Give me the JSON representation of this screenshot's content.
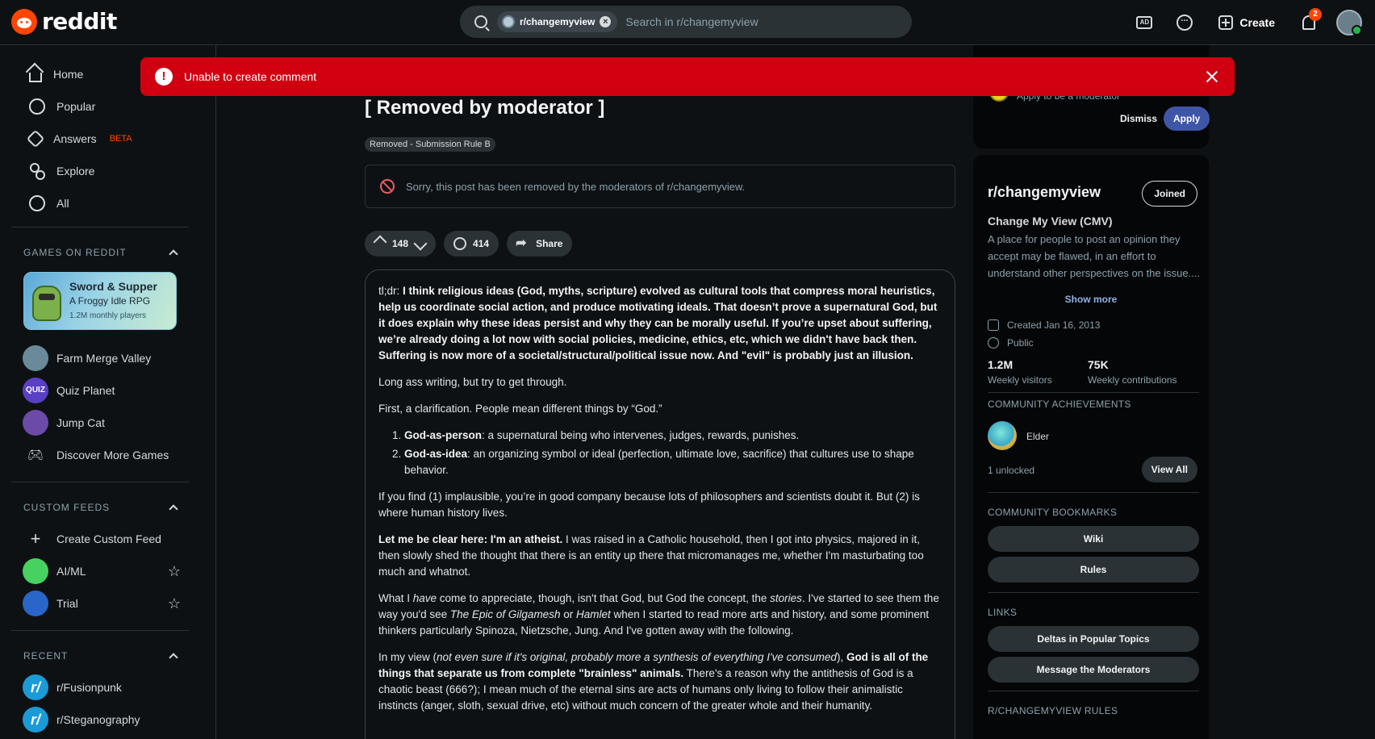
{
  "header": {
    "logo_text": "reddit",
    "search_chip": "r/changemyview",
    "search_placeholder": "Search in r/changemyview",
    "create_label": "Create",
    "notif_count": "2"
  },
  "toast": {
    "message": "Unable to create comment",
    "color": "#d00010"
  },
  "sidebar": {
    "nav": [
      {
        "label": "Home",
        "icon": "home-icon"
      },
      {
        "label": "Popular",
        "icon": "popular-icon"
      },
      {
        "label": "Answers",
        "icon": "answers-icon",
        "badge": "BETA"
      },
      {
        "label": "Explore",
        "icon": "explore-icon"
      },
      {
        "label": "All",
        "icon": "all-icon"
      }
    ],
    "games_title": "GAMES ON REDDIT",
    "game_card": {
      "title": "Sword & Supper",
      "subtitle": "A Froggy Idle RPG",
      "players": "1.2M monthly players"
    },
    "games": [
      {
        "label": "Farm Merge Valley"
      },
      {
        "label": "Quiz Planet"
      },
      {
        "label": "Jump Cat"
      },
      {
        "label": "Discover More Games"
      }
    ],
    "feeds_title": "CUSTOM FEEDS",
    "feeds": [
      {
        "label": "Create Custom Feed"
      },
      {
        "label": "AI/ML"
      },
      {
        "label": "Trial"
      }
    ],
    "recent_title": "RECENT",
    "recent": [
      {
        "label": "r/Fusionpunk"
      },
      {
        "label": "r/Steganography"
      }
    ]
  },
  "post": {
    "title": "[ Removed by moderator ]",
    "flair": "Removed - Submission Rule B",
    "removed_notice": "Sorry, this post has been removed by the moderators of r/changemyview.",
    "votes": "148",
    "comments": "414",
    "share_label": "Share",
    "body": {
      "tldr_prefix": "tl;dr:",
      "tldr": " I think religious ideas (God, myths, scripture) evolved as cultural tools that compress moral heuristics, help us coordinate social action, and produce motivating ideals. That doesn’t prove a supernatural God, but it does explain why these ideas persist and why they can be morally useful. If you’re upset about suffering, we’re already doing a lot now with social policies, medicine, ethics, etc, which we didn't have back then. Suffering is now more of a societal/structural/political issue now. And \"evil\" is probably just an illusion.",
      "p1": "Long ass writing, but try to get through.",
      "p2": "First, a clarification. People mean different things by “God.”",
      "li1_b": "God-as-person",
      "li1": ": a supernatural being who intervenes, judges, rewards, punishes.",
      "li2_b": "God-as-idea",
      "li2": ": an organizing symbol or ideal (perfection, ultimate love, sacrifice) that cultures use to shape behavior.",
      "p3": "If you find (1) implausible, you’re in good company because lots of philosophers and scientists doubt it. But (2) is where human history lives.",
      "p4_b": "Let me be clear here: I'm an atheist.",
      "p4": " I was raised in a Catholic household, then I got into physics, majored in it, then slowly shed the thought that there is an entity up there that micromanages me, whether I'm masturbating too much and whatnot.",
      "p5_a": "What I ",
      "p5_i1": "have",
      "p5_b": " come to appreciate, though, isn't that God, but God the concept, the ",
      "p5_i2": "stories",
      "p5_c": ". I've started to see them the way you'd see ",
      "p5_i3": "The Epic of Gilgamesh",
      "p5_d": " or ",
      "p5_i4": "Hamlet",
      "p5_e": " when I started to read more arts and history, and some prominent thinkers particularly Spinoza, Nietzsche, Jung. And I've gotten away with the following.",
      "p6_a": "In my view (",
      "p6_i": "not even sure if it's original, probably more a synthesis of everything I've consumed",
      "p6_b": "), ",
      "p6_bold": "God is all of the things that separate us from complete \"brainless\" animals.",
      "p6_c": " There's a reason why the antithesis of God is a chaotic beast (666?); I mean much of the eternal sins are acts of humans only living to follow their animalistic instincts (anger, sloth, sexual drive, etc) without much concern of the greater whole and their humanity."
    }
  },
  "right": {
    "apply_text": "Apply to be a moderator",
    "dismiss": "Dismiss",
    "apply": "Apply",
    "sub_name": "r/changemyview",
    "joined": "Joined",
    "full_name": "Change My View (CMV)",
    "desc": "A place for people to post an opinion they accept may be flawed, in an effort to understand other perspectives on the issue....",
    "show_more": "Show more",
    "created": "Created Jan 16, 2013",
    "visibility": "Public",
    "visitors_num": "1.2M",
    "visitors_lbl": "Weekly visitors",
    "contrib_num": "75K",
    "contrib_lbl": "Weekly contributions",
    "achievements_title": "COMMUNITY ACHIEVEMENTS",
    "achievement": "Elder",
    "unlocked": "1 unlocked",
    "view_all": "View All",
    "bookmarks_title": "COMMUNITY BOOKMARKS",
    "bookmarks": [
      "Wiki",
      "Rules"
    ],
    "links_title": "LINKS",
    "links": [
      "Deltas in Popular Topics",
      "Message the Moderators"
    ],
    "rules_title": "R/CHANGEMYVIEW RULES"
  }
}
